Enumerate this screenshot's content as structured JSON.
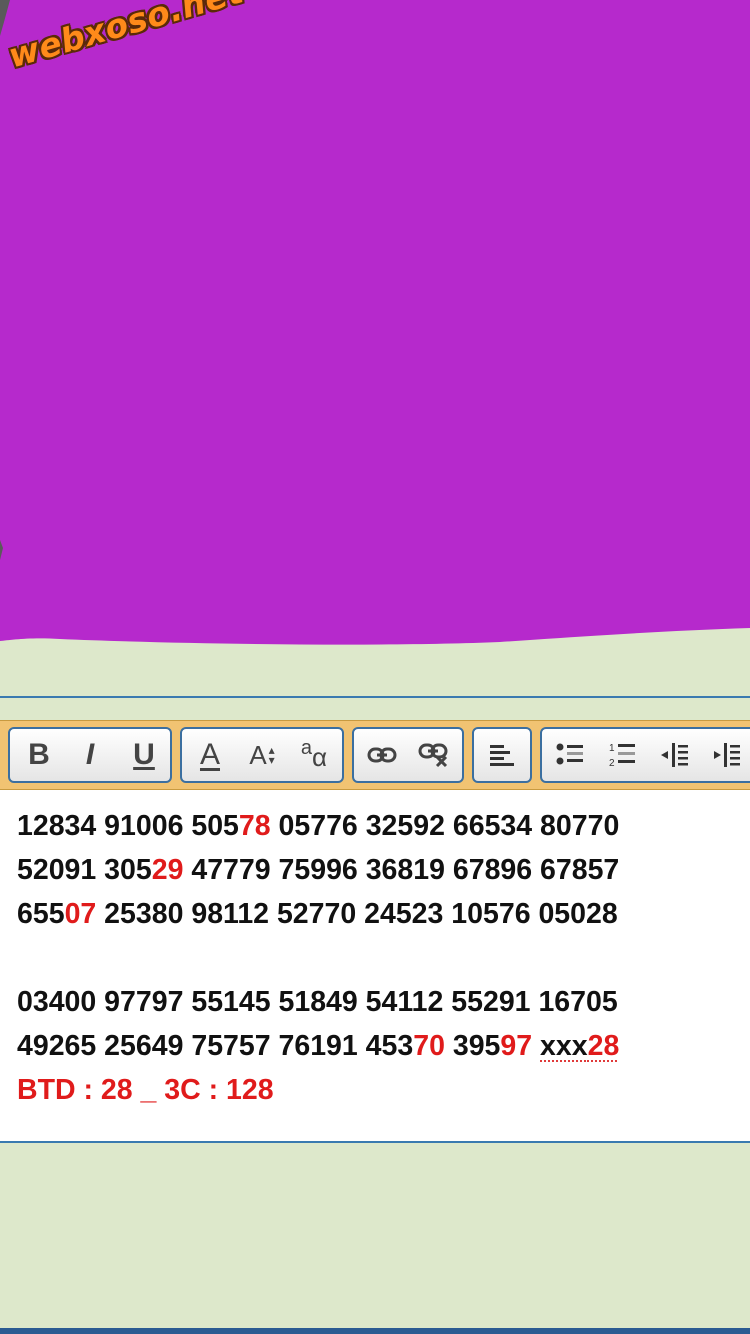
{
  "watermark": {
    "text": "webxoso.net"
  },
  "colors": {
    "purple": "#b629cc",
    "page_bg": "#dde8cb",
    "toolbar_bg": "#f1c372",
    "border_blue": "#3a7ab0",
    "highlight_red": "#e01b1b"
  },
  "toolbar": {
    "bold": "B",
    "italic": "I",
    "underline": "U",
    "font_color": "A",
    "font_size": "A",
    "font_case": "a",
    "groups": [
      {
        "name": "text-style",
        "buttons": [
          "bold-button",
          "italic-button",
          "underline-button"
        ]
      },
      {
        "name": "font",
        "buttons": [
          "font-color-button",
          "font-size-button",
          "font-case-button"
        ]
      },
      {
        "name": "link",
        "buttons": [
          "insert-link-button",
          "remove-link-button"
        ]
      },
      {
        "name": "align",
        "buttons": [
          "align-left-button"
        ]
      },
      {
        "name": "list",
        "buttons": [
          "bulleted-list-button",
          "numbered-list-button",
          "outdent-button",
          "indent-button"
        ]
      }
    ]
  },
  "editor": {
    "lines": [
      [
        {
          "t": "12834 91006 505"
        },
        {
          "t": "78",
          "red": true
        },
        {
          "t": " 05776 32592 66534 80770"
        }
      ],
      [
        {
          "t": "52091 305"
        },
        {
          "t": "29",
          "red": true
        },
        {
          "t": " 47779 75996 36819 67896 67857"
        }
      ],
      [
        {
          "t": "655"
        },
        {
          "t": "07",
          "red": true
        },
        {
          "t": " 25380 98112 52770 24523 10576 05028"
        }
      ],
      [],
      [
        {
          "t": "03400 97797 55145 51849 54112 55291 16705"
        }
      ],
      [
        {
          "t": "49265 25649 75757 76191 453"
        },
        {
          "t": "70",
          "red": true
        },
        {
          "t": " 395"
        },
        {
          "t": "97",
          "red": true
        },
        {
          "t": " "
        },
        {
          "t": "xxx",
          "misspelled": true
        },
        {
          "t": "28",
          "red": true,
          "misspelled": true
        }
      ],
      [
        {
          "t": "BTD : 28 _ 3C : 128",
          "red": true
        }
      ]
    ]
  }
}
